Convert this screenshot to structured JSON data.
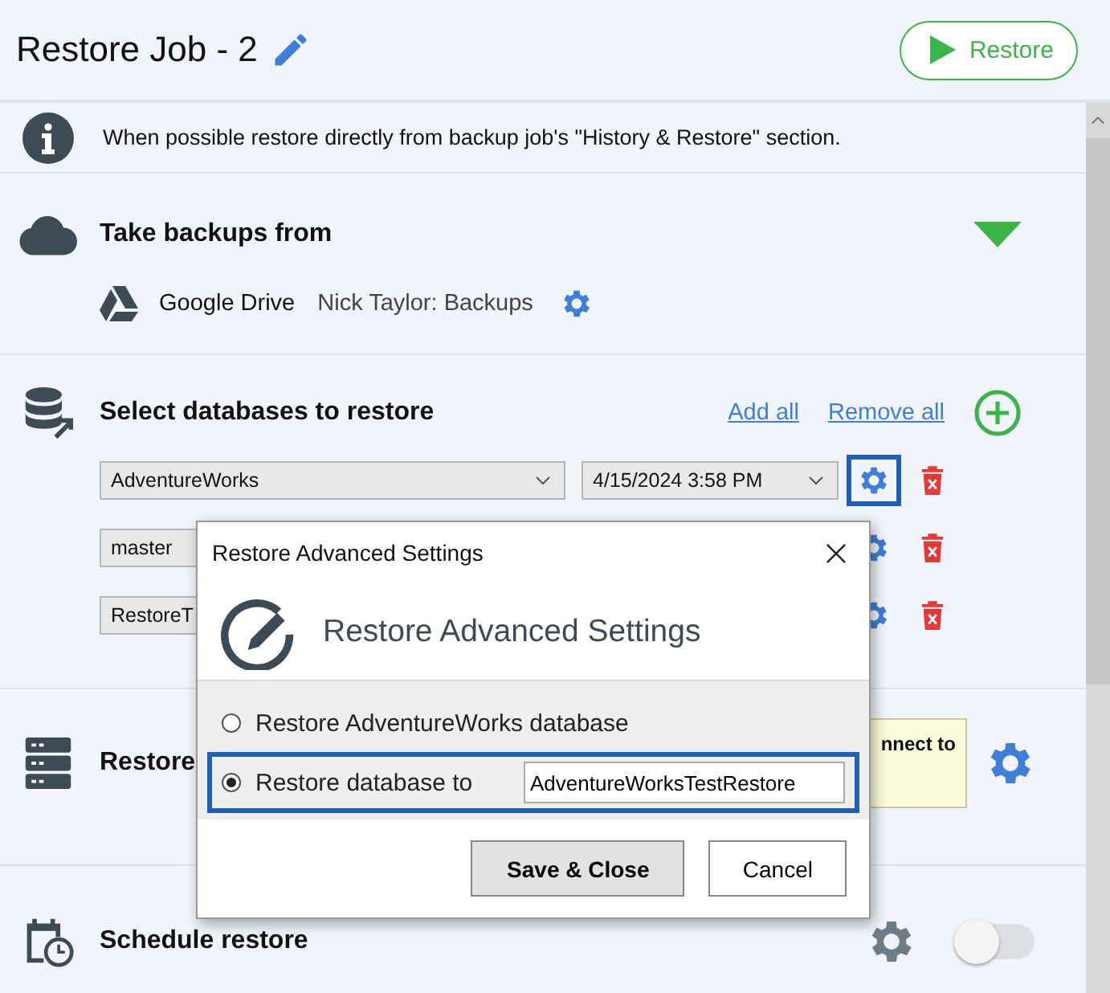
{
  "header": {
    "title": "Restore Job - 2",
    "restore_button": "Restore"
  },
  "info": {
    "text": "When possible restore directly from backup job's \"History & Restore\" section."
  },
  "source": {
    "title": "Take backups from",
    "expanded": true,
    "provider": "Google Drive",
    "account": "Nick Taylor: Backups"
  },
  "databases": {
    "title": "Select databases to restore",
    "add_all": "Add all",
    "remove_all": "Remove all",
    "rows": [
      {
        "database": "AdventureWorks",
        "backup": "4/15/2024 3:58 PM",
        "selected": true
      },
      {
        "database": "master",
        "selected": false
      },
      {
        "database": "RestoreT",
        "selected": false
      }
    ]
  },
  "target": {
    "title": "Restore",
    "tooltip": "nnect to"
  },
  "schedule": {
    "title": "Schedule restore",
    "on": false
  },
  "dialog": {
    "title": "Restore Advanced Settings",
    "heading": "Restore Advanced Settings",
    "options": [
      {
        "label": "Restore AdventureWorks database",
        "selected": false
      },
      {
        "label": "Restore database to",
        "selected": true,
        "value": "AdventureWorksTestRestore"
      }
    ],
    "buttons": [
      {
        "label": "Save & Close",
        "kind": "primary"
      },
      {
        "label": "Cancel",
        "kind": "secondary"
      }
    ]
  }
}
